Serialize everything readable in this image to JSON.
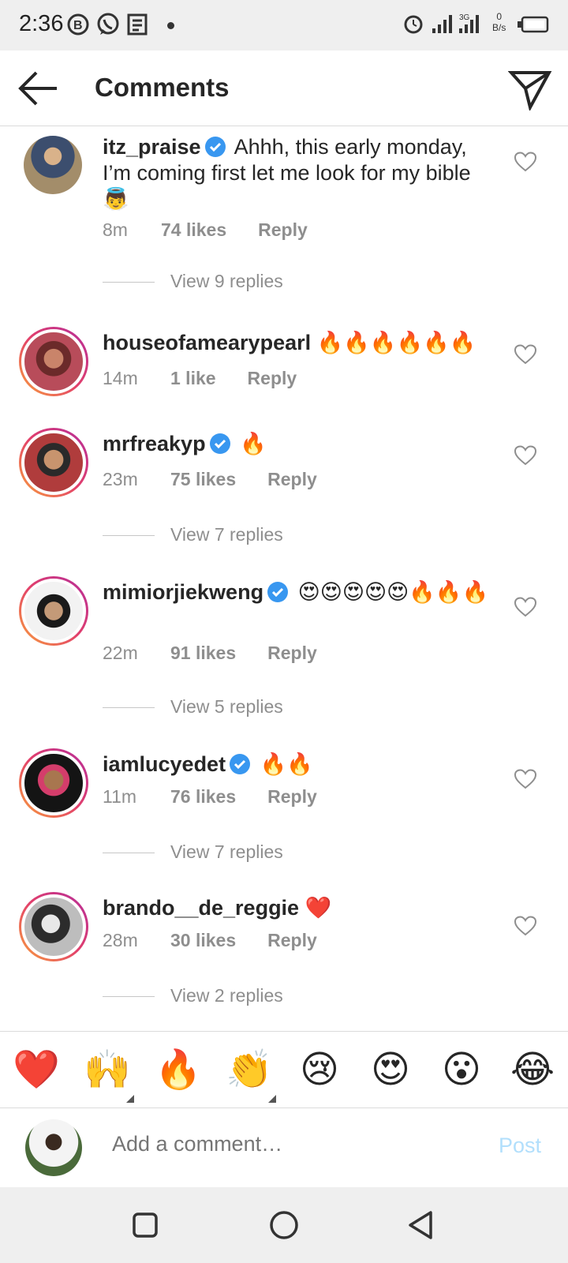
{
  "status_bar": {
    "time": "2:36",
    "network_speed_value": "0",
    "network_speed_unit": "B/s",
    "network_type": "3G",
    "icons": [
      "b-app-icon",
      "whatsapp-icon",
      "news-icon",
      "alarm-icon",
      "signal-icon",
      "signal-3g-icon",
      "battery-icon"
    ]
  },
  "header": {
    "title": "Comments",
    "back_icon": "arrow-left-icon",
    "share_icon": "paper-plane-icon"
  },
  "comments": [
    {
      "username": "itz_praise",
      "verified": true,
      "text": "Ahhh, this early monday, I’m coming first let me look for my bible 👼",
      "time": "8m",
      "likes": "74 likes",
      "reply": "Reply",
      "view_replies": "View 9 replies"
    },
    {
      "username": "houseofamearypearl",
      "verified": false,
      "text": "🔥🔥🔥🔥🔥🔥",
      "time": "14m",
      "likes": "1 like",
      "reply": "Reply",
      "view_replies": ""
    },
    {
      "username": "mrfreakyp",
      "verified": true,
      "text": "🔥",
      "time": "23m",
      "likes": "75 likes",
      "reply": "Reply",
      "view_replies": "View 7 replies"
    },
    {
      "username": "mimiorjiekweng",
      "verified": true,
      "text": "😍😍😍😍😍🔥🔥🔥",
      "time": "22m",
      "likes": "91 likes",
      "reply": "Reply",
      "view_replies": "View 5 replies"
    },
    {
      "username": "iamlucyedet",
      "verified": true,
      "text": "🔥🔥",
      "time": "11m",
      "likes": "76 likes",
      "reply": "Reply",
      "view_replies": "View 7 replies"
    },
    {
      "username": "brando__de_reggie",
      "verified": false,
      "text": "❤️",
      "time": "28m",
      "likes": "30 likes",
      "reply": "Reply",
      "view_replies": "View 2 replies"
    }
  ],
  "emoji_bar": [
    "❤️",
    "🙌",
    "🔥",
    "👏",
    "😢",
    "😍",
    "😮",
    "😂"
  ],
  "composer": {
    "placeholder": "Add a comment…",
    "post_label": "Post"
  },
  "colors": {
    "link_disabled": "#b2dffc",
    "verified": "#3897f0",
    "meta": "#8e8e8e"
  }
}
